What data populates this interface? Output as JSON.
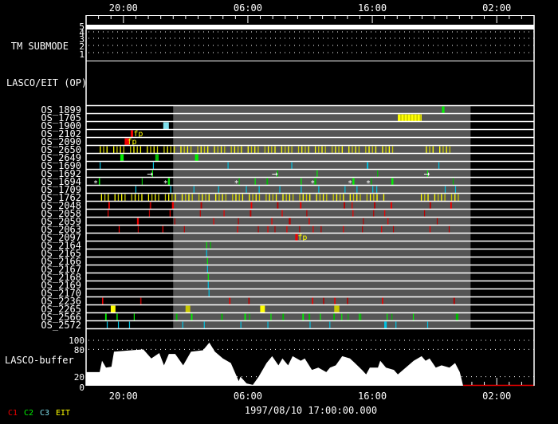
{
  "chart_data": {
    "type": "timeline",
    "start_label": "1997/08/10 17:00:00.000",
    "x_unit": "hours since start",
    "x_range": [
      0,
      36
    ],
    "x_ticks": [
      {
        "hour": 3,
        "label": "20:00"
      },
      {
        "hour": 13,
        "label": "06:00"
      },
      {
        "hour": 23,
        "label": "16:00"
      },
      {
        "hour": 33,
        "label": "02:00"
      }
    ],
    "submode_panel": {
      "label": "TM SUBMODE",
      "levels": [
        "5",
        "4",
        "3",
        "2",
        "1"
      ],
      "value": 5
    },
    "op_panel": {
      "label": "LASCO/EIT (OP)"
    },
    "shaded_interval": [
      7.0,
      30.9
    ],
    "colors": {
      "C1": "#ee0000",
      "C2": "#00ee00",
      "C3": "#7fdfec",
      "EIT": "#ffff00",
      "shade": "#555555"
    },
    "annotation_text": "fp",
    "rows": [
      {
        "name": "OS_1899",
        "events": [
          [
            28.6,
            "C2",
            0.2
          ]
        ]
      },
      {
        "name": "OS_1705",
        "blocks": [
          [
            25.05,
            26.96,
            "EIT"
          ]
        ]
      },
      {
        "name": "OS_1900",
        "events": [
          [
            6.2,
            "C3b",
            0.45
          ]
        ]
      },
      {
        "name": "OS_2102",
        "events": [
          [
            3.58,
            "C1",
            0.2
          ]
        ],
        "annot": [
          3.8
        ]
      },
      {
        "name": "OS_2090",
        "events": [
          [
            3.1,
            "C1",
            0.4
          ]
        ],
        "annot": [
          3.3
        ]
      },
      {
        "name": "OS_2650",
        "ticks": [
          [
            1.1,
            24.6,
            0.27,
            "EIT"
          ],
          [
            27.3,
            29.7,
            0.27,
            "EIT"
          ]
        ]
      },
      {
        "name": "OS_2649",
        "events": [
          [
            2.75,
            "C2",
            0.27
          ],
          [
            5.56,
            "C2",
            0.27
          ],
          [
            8.75,
            "C2",
            0.27
          ]
        ]
      },
      {
        "name": "OS_1690",
        "events": [
          [
            1.09,
            "C3",
            0.07
          ],
          [
            5.37,
            "C3",
            0.07
          ],
          [
            11.37,
            "C3",
            0.07
          ],
          [
            16.49,
            "C3",
            0.07
          ],
          [
            22.56,
            "C3",
            0.12
          ],
          [
            28.31,
            "C3",
            0.07
          ]
        ]
      },
      {
        "name": "OS_1692",
        "events": [
          [
            5.3,
            "C2",
            0.07
          ],
          [
            15.34,
            "C2",
            0.1
          ],
          [
            18.53,
            "C2",
            0.07
          ],
          [
            23.39,
            "C2",
            0.07
          ],
          [
            27.41,
            "C2",
            0.07
          ]
        ],
        "arrows": [
          5.11,
          15.14,
          27.35
        ]
      },
      {
        "name": "OS_1694",
        "events": [
          [
            1.02,
            "C2",
            0.1
          ],
          [
            4.47,
            "C2",
            0.07
          ],
          [
            6.58,
            "C2",
            0.15
          ],
          [
            12.27,
            "C2",
            0.07
          ],
          [
            13.55,
            "C2",
            0.07
          ],
          [
            14.5,
            "C2",
            0.12
          ],
          [
            17.25,
            "C2",
            0.07
          ],
          [
            18.34,
            "C2",
            0.15
          ],
          [
            21.41,
            "C2",
            0.15
          ],
          [
            22.88,
            "C2",
            0.07
          ],
          [
            24.54,
            "C2",
            0.15
          ],
          [
            29.46,
            "C2",
            0.07
          ]
        ],
        "stars": [
          0.77,
          6.39,
          12.08,
          18.21,
          21.21,
          22.68
        ]
      },
      {
        "name": "OS_1709",
        "events": [
          [
            3.96,
            "C3",
            0.07
          ],
          [
            6.77,
            "C3",
            0.07
          ],
          [
            8.63,
            "C3",
            0.07
          ],
          [
            10.61,
            "C3",
            0.07
          ],
          [
            12.84,
            "C3",
            0.07
          ],
          [
            13.87,
            "C3",
            0.07
          ],
          [
            15.53,
            "C3",
            0.07
          ],
          [
            17.25,
            "C3",
            0.07
          ],
          [
            18.66,
            "C3",
            0.07
          ],
          [
            20.77,
            "C3",
            0.07
          ],
          [
            21.73,
            "C3",
            0.07
          ],
          [
            23.0,
            "C3",
            0.07
          ],
          [
            23.32,
            "C3",
            0.07
          ],
          [
            28.82,
            "C3",
            0.07
          ],
          [
            29.65,
            "C3",
            0.07
          ]
        ]
      },
      {
        "name": "OS_1762",
        "ticks": [
          [
            1.2,
            24.1,
            0.27,
            "EIT"
          ],
          [
            26.9,
            29.9,
            0.27,
            "EIT"
          ]
        ]
      },
      {
        "name": "OS_2048",
        "events": [
          [
            1.79,
            "C1",
            0.12
          ],
          [
            5.11,
            "C1",
            0.12
          ],
          [
            6.9,
            "C1",
            0.15
          ],
          [
            9.2,
            "C1",
            0.12
          ],
          [
            13.23,
            "C1",
            0.12
          ],
          [
            15.34,
            "C1",
            0.12
          ],
          [
            17.19,
            "C1",
            0.12
          ],
          [
            20.7,
            "C1",
            0.12
          ],
          [
            21.34,
            "C1",
            0.07
          ],
          [
            23.13,
            "C1",
            0.12
          ],
          [
            24.47,
            "C1",
            0.12
          ],
          [
            27.6,
            "C1",
            0.12
          ],
          [
            29.27,
            "C1",
            0.12
          ]
        ]
      },
      {
        "name": "OS_2058",
        "events": [
          [
            1.73,
            "C1",
            0.07
          ],
          [
            5.05,
            "C1",
            0.07
          ],
          [
            6.71,
            "C1",
            0.07
          ],
          [
            9.14,
            "C1",
            0.07
          ],
          [
            11.05,
            "C1",
            0.07
          ],
          [
            13.16,
            "C1",
            0.12
          ],
          [
            15.72,
            "C1",
            0.07
          ],
          [
            17.7,
            "C1",
            0.07
          ],
          [
            21.41,
            "C1",
            0.07
          ],
          [
            23.07,
            "C1",
            0.07
          ],
          [
            23.96,
            "C1",
            0.07
          ],
          [
            27.16,
            "C1",
            0.07
          ]
        ]
      },
      {
        "name": "OS_2059",
        "events": [
          [
            4.09,
            "C1",
            0.15
          ],
          [
            7.09,
            "C1",
            0.07
          ],
          [
            10.22,
            "C1",
            0.07
          ],
          [
            12.2,
            "C1",
            0.07
          ],
          [
            14.89,
            "C1",
            0.07
          ],
          [
            16.29,
            "C1",
            0.15
          ],
          [
            17.89,
            "C1",
            0.07
          ],
          [
            22.24,
            "C1",
            0.07
          ],
          [
            24.22,
            "C1",
            0.07
          ],
          [
            28.18,
            "C1",
            0.07
          ]
        ]
      },
      {
        "name": "OS_2063",
        "events": [
          [
            2.62,
            "C1",
            0.07
          ],
          [
            4.15,
            "C1",
            0.07
          ],
          [
            6.13,
            "C1",
            0.07
          ],
          [
            7.86,
            "C1",
            0.07
          ],
          [
            12.14,
            "C1",
            0.07
          ],
          [
            13.8,
            "C1",
            0.07
          ],
          [
            14.57,
            "C1",
            0.07
          ],
          [
            15.14,
            "C1",
            0.07
          ],
          [
            16.1,
            "C1",
            0.07
          ],
          [
            17.12,
            "C1",
            0.07
          ],
          [
            18.21,
            "C1",
            0.07
          ],
          [
            18.85,
            "C1",
            0.07
          ],
          [
            20.64,
            "C1",
            0.07
          ],
          [
            22.17,
            "C1",
            0.07
          ],
          [
            23.71,
            "C1",
            0.07
          ],
          [
            24.66,
            "C1",
            0.07
          ],
          [
            27.6,
            "C1",
            0.07
          ],
          [
            29.14,
            "C1",
            0.07
          ]
        ]
      },
      {
        "name": "OS_2097",
        "events": [
          [
            16.81,
            "C1",
            0.2
          ]
        ],
        "annot": [
          17.0
        ]
      },
      {
        "name": "OS_2164",
        "events": [
          [
            9.65,
            "C2",
            0.07
          ],
          [
            9.97,
            "C2",
            0.07
          ]
        ]
      },
      {
        "name": "OS_2165",
        "events": [
          [
            9.65,
            "C3",
            0.07
          ]
        ]
      },
      {
        "name": "OS_2166",
        "events": [
          [
            9.72,
            "C2",
            0.07
          ]
        ]
      },
      {
        "name": "OS_2167",
        "events": [
          [
            9.72,
            "C3",
            0.07
          ]
        ]
      },
      {
        "name": "OS_2168",
        "events": [
          [
            9.78,
            "C2",
            0.07
          ]
        ]
      },
      {
        "name": "OS_2169",
        "events": [
          [
            9.78,
            "C3",
            0.07
          ]
        ]
      },
      {
        "name": "OS_2170",
        "events": [
          [
            9.84,
            "C3",
            0.07
          ]
        ]
      },
      {
        "name": "OS_2236",
        "events": [
          [
            1.28,
            "C1",
            0.1
          ],
          [
            4.35,
            "C1",
            0.1
          ],
          [
            11.5,
            "C1",
            0.1
          ],
          [
            13.04,
            "C1",
            0.1
          ],
          [
            18.15,
            "C1",
            0.1
          ],
          [
            19.04,
            "C1",
            0.1
          ],
          [
            19.94,
            "C1",
            0.1
          ],
          [
            20.96,
            "C1",
            0.1
          ],
          [
            23.77,
            "C1",
            0.1
          ],
          [
            29.52,
            "C1",
            0.12
          ]
        ]
      },
      {
        "name": "OS_2265",
        "blocks": [
          [
            1.98,
            2.36,
            "EIT"
          ],
          [
            7.99,
            8.37,
            "EITd"
          ],
          [
            13.99,
            14.37,
            "EIT"
          ],
          [
            19.94,
            20.35,
            "EITd"
          ]
        ]
      },
      {
        "name": "OS_2566",
        "events": [
          [
            1.53,
            "C2",
            0.12
          ],
          [
            2.43,
            "C2",
            0.12
          ],
          [
            3.83,
            "C2",
            0.07
          ],
          [
            7.22,
            "C2",
            0.12
          ],
          [
            8.43,
            "C2",
            0.12
          ],
          [
            10.86,
            "C2",
            0.12
          ],
          [
            12.72,
            "C2",
            0.12
          ],
          [
            13.1,
            "C2",
            0.07
          ],
          [
            14.82,
            "C2",
            0.07
          ],
          [
            15.78,
            "C2",
            0.12
          ],
          [
            17.38,
            "C2",
            0.12
          ],
          [
            17.89,
            "C2",
            0.12
          ],
          [
            18.79,
            "C2",
            0.07
          ],
          [
            19.87,
            "C2",
            0.12
          ],
          [
            20.51,
            "C2",
            0.07
          ],
          [
            21.02,
            "C2",
            0.07
          ],
          [
            21.92,
            "C2",
            0.07
          ],
          [
            22.04,
            "C2",
            0.07
          ],
          [
            24.15,
            "C2",
            0.07
          ],
          [
            24.54,
            "C2",
            0.07
          ],
          [
            26.26,
            "C2",
            0.07
          ],
          [
            29.71,
            "C2",
            0.2
          ]
        ]
      },
      {
        "name": "OS_2572",
        "events": [
          [
            1.66,
            "C3",
            0.07
          ],
          [
            2.56,
            "C3",
            0.07
          ],
          [
            3.45,
            "C3",
            0.07
          ],
          [
            7.73,
            "C3",
            0.07
          ],
          [
            9.46,
            "C3",
            0.07
          ],
          [
            12.4,
            "C3",
            0.07
          ],
          [
            14.57,
            "C3",
            0.07
          ],
          [
            17.96,
            "C3",
            0.07
          ],
          [
            19.55,
            "C3",
            0.07
          ],
          [
            23.96,
            "C3",
            0.2
          ],
          [
            24.86,
            "C3",
            0.07
          ],
          [
            27.41,
            "C3",
            0.07
          ]
        ]
      }
    ],
    "buffer": {
      "label": "LASCO-buffer",
      "y_ticks": [
        "100",
        "80",
        "20",
        "0"
      ],
      "ylim": [
        0,
        100
      ],
      "points": [
        [
          0,
          30
        ],
        [
          1.09,
          30
        ],
        [
          1.28,
          55
        ],
        [
          1.6,
          40
        ],
        [
          2.04,
          42
        ],
        [
          2.24,
          75
        ],
        [
          3.64,
          78
        ],
        [
          4.6,
          80
        ],
        [
          5.24,
          60
        ],
        [
          5.88,
          72
        ],
        [
          6.26,
          45
        ],
        [
          6.65,
          70
        ],
        [
          7.16,
          70
        ],
        [
          7.8,
          45
        ],
        [
          8.43,
          75
        ],
        [
          9.39,
          78
        ],
        [
          9.9,
          95
        ],
        [
          10.35,
          75
        ],
        [
          10.99,
          60
        ],
        [
          11.63,
          50
        ],
        [
          12.27,
          10
        ],
        [
          12.4,
          20
        ],
        [
          12.9,
          5
        ],
        [
          13.4,
          2
        ],
        [
          13.87,
          20
        ],
        [
          14.5,
          50
        ],
        [
          14.95,
          65
        ],
        [
          15.46,
          45
        ],
        [
          15.78,
          60
        ],
        [
          16.23,
          45
        ],
        [
          16.6,
          65
        ],
        [
          17.25,
          55
        ],
        [
          17.57,
          60
        ],
        [
          18.15,
          35
        ],
        [
          18.66,
          40
        ],
        [
          19.3,
          30
        ],
        [
          19.6,
          40
        ],
        [
          20.06,
          45
        ],
        [
          20.58,
          65
        ],
        [
          21.2,
          60
        ],
        [
          21.6,
          50
        ],
        [
          22.17,
          35
        ],
        [
          22.5,
          25
        ],
        [
          22.8,
          40
        ],
        [
          23.45,
          40
        ],
        [
          23.64,
          55
        ],
        [
          24.1,
          40
        ],
        [
          24.73,
          35
        ],
        [
          25.05,
          25
        ],
        [
          25.69,
          40
        ],
        [
          26.33,
          55
        ],
        [
          26.96,
          65
        ],
        [
          27.28,
          55
        ],
        [
          27.6,
          60
        ],
        [
          28.1,
          40
        ],
        [
          28.56,
          45
        ],
        [
          29.2,
          40
        ],
        [
          29.65,
          50
        ],
        [
          30.03,
          30
        ],
        [
          30.3,
          0
        ]
      ],
      "no_data_interval": [
        30.3,
        36
      ]
    },
    "legend": [
      {
        "label": "C1",
        "color": "#ee0000"
      },
      {
        "label": "C2",
        "color": "#00ee00"
      },
      {
        "label": "C3",
        "color": "#7fdfec"
      },
      {
        "label": "EIT",
        "color": "#ffff00"
      }
    ]
  }
}
